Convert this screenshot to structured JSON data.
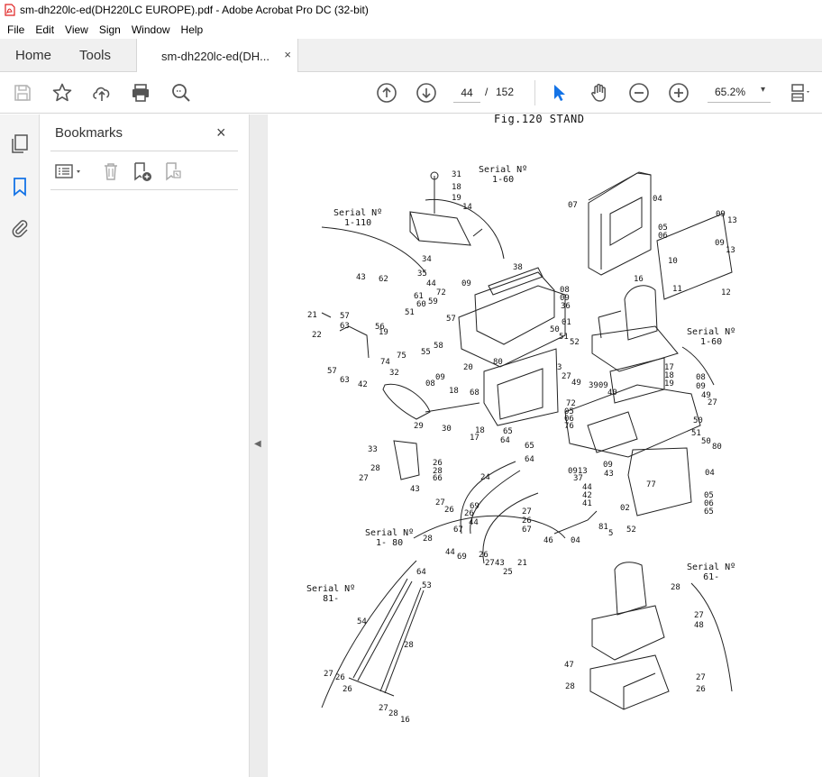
{
  "window": {
    "title": "sm-dh220lc-ed(DH220LC EUROPE).pdf - Adobe Acrobat Pro DC (32-bit)"
  },
  "menu": [
    "File",
    "Edit",
    "View",
    "Sign",
    "Window",
    "Help"
  ],
  "tabs": {
    "home": "Home",
    "tools": "Tools",
    "document": "sm-dh220lc-ed(DH...",
    "close": "×"
  },
  "toolbar": {
    "icons": [
      "save-icon",
      "star-icon",
      "upload-icon",
      "print-icon",
      "zoom-search-icon",
      "page-up-icon",
      "page-down-icon",
      "select-cursor-icon",
      "hand-icon",
      "zoom-out-icon",
      "zoom-in-icon",
      "page-layout-icon"
    ],
    "current_page": "44",
    "page_separator": "/",
    "total_pages": "152",
    "zoom": "65.2%",
    "zoom_chevron": "▾"
  },
  "colors": {
    "accent": "#1473e6",
    "pdf_red": "#e02020",
    "icon_gray": "#6e6e6e"
  },
  "sidebar": {
    "title": "Bookmarks",
    "close": "×",
    "rail_icons": [
      "page-thumbnails-icon",
      "bookmark-icon",
      "attachment-icon"
    ],
    "panel_tools": [
      "bookmark-options-icon",
      "delete-bookmark-icon",
      "new-bookmark-icon",
      "bookmark-from-tag-icon"
    ]
  },
  "collapse_arrow": "◀",
  "document": {
    "figure_title": "Fig.120  STAND",
    "serial_labels": [
      "Serial Nº\n1-60",
      "Serial Nº\n1-110",
      "Serial Nº\n1-60",
      "Serial Nº\n1- 80",
      "Serial Nº\n61-",
      "Serial Nº\n81-"
    ],
    "part_numbers": [
      "31",
      "18",
      "19",
      "14",
      "07",
      "04",
      "05",
      "06",
      "09",
      "13",
      "10",
      "09",
      "13",
      "11",
      "12",
      "34",
      "38",
      "08",
      "09",
      "36",
      "35",
      "44",
      "09",
      "72",
      "59",
      "43",
      "62",
      "61",
      "60",
      "51",
      "57",
      "21",
      "57",
      "63",
      "56",
      "19",
      "58",
      "22",
      "75",
      "74",
      "55",
      "63",
      "57",
      "42",
      "32",
      "09",
      "08",
      "20",
      "68",
      "18",
      "16",
      "01",
      "50",
      "51",
      "52",
      "80",
      "3",
      "27",
      "49",
      "3909",
      "40",
      "17",
      "18",
      "19",
      "08",
      "09",
      "49",
      "27",
      "29",
      "30",
      "17",
      "18",
      "65",
      "64",
      "65",
      "64",
      "33",
      "28",
      "27",
      "26",
      "28",
      "66",
      "24",
      "43",
      "27",
      "26",
      "69",
      "26",
      "44",
      "67",
      "28",
      "27",
      "26",
      "67",
      "44",
      "69",
      "26",
      "27",
      "43",
      "25",
      "21",
      "46",
      "04",
      "72",
      "05",
      "06",
      "76",
      "0913",
      "37",
      "09",
      "43",
      "44",
      "42",
      "41",
      "81",
      "5",
      "02",
      "52",
      "77",
      "50",
      "51",
      "50",
      "80",
      "04",
      "05",
      "06",
      "65",
      "64",
      "53",
      "54",
      "28",
      "27",
      "26",
      "26",
      "27",
      "28",
      "16",
      "28",
      "27",
      "48",
      "47",
      "28",
      "27",
      "26"
    ]
  }
}
